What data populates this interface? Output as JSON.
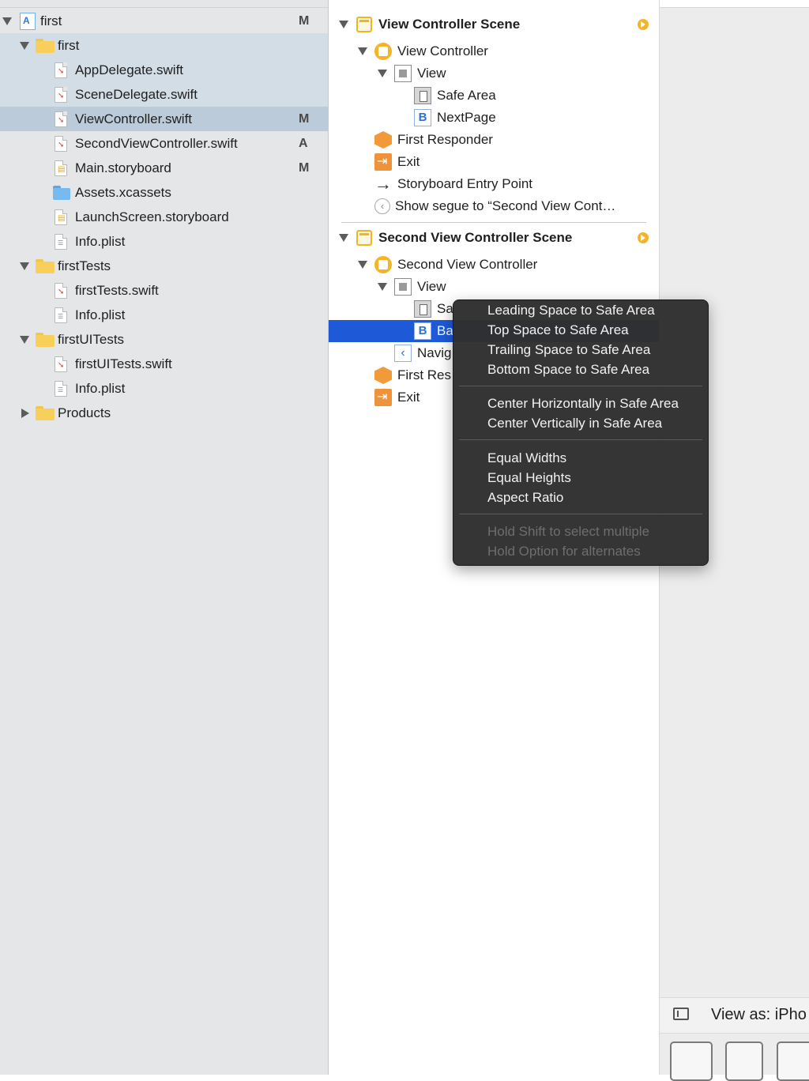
{
  "navigator": {
    "items": [
      {
        "label": "first",
        "status": "M",
        "kind": "project"
      },
      {
        "label": "first",
        "status": "",
        "kind": "folder"
      },
      {
        "label": "AppDelegate.swift",
        "status": "",
        "kind": "swift"
      },
      {
        "label": "SceneDelegate.swift",
        "status": "",
        "kind": "swift"
      },
      {
        "label": "ViewController.swift",
        "status": "M",
        "kind": "swift",
        "selected": true
      },
      {
        "label": "SecondViewController.swift",
        "status": "A",
        "kind": "swift"
      },
      {
        "label": "Main.storyboard",
        "status": "M",
        "kind": "storyboard"
      },
      {
        "label": "Assets.xcassets",
        "status": "",
        "kind": "assets"
      },
      {
        "label": "LaunchScreen.storyboard",
        "status": "",
        "kind": "storyboard"
      },
      {
        "label": "Info.plist",
        "status": "",
        "kind": "plist"
      },
      {
        "label": "firstTests",
        "status": "",
        "kind": "folder"
      },
      {
        "label": "firstTests.swift",
        "status": "",
        "kind": "swift"
      },
      {
        "label": "Info.plist",
        "status": "",
        "kind": "plist"
      },
      {
        "label": "firstUITests",
        "status": "",
        "kind": "folder"
      },
      {
        "label": "firstUITests.swift",
        "status": "",
        "kind": "swift"
      },
      {
        "label": "Info.plist",
        "status": "",
        "kind": "plist"
      },
      {
        "label": "Products",
        "status": "",
        "kind": "folder"
      }
    ]
  },
  "outline": {
    "scene1": {
      "title": "View Controller Scene",
      "view_controller": "View Controller",
      "view": "View",
      "safe_area": "Safe Area",
      "button": "NextPage",
      "first_responder": "First Responder",
      "exit": "Exit",
      "entry_point": "Storyboard Entry Point",
      "segue": "Show segue to “Second View Cont…"
    },
    "scene2": {
      "title": "Second View Controller Scene",
      "view_controller": "Second View Controller",
      "view": "View",
      "safe_area": "Sa",
      "button": "Ba",
      "navigation": "Navig",
      "first_responder": "First Res",
      "exit": "Exit"
    }
  },
  "context_menu": {
    "group1": [
      "Leading Space to Safe Area",
      "Top Space to Safe Area",
      "Trailing Space to Safe Area",
      "Bottom Space to Safe Area"
    ],
    "group2": [
      "Center Horizontally in Safe Area",
      "Center Vertically in Safe Area"
    ],
    "group3": [
      "Equal Widths",
      "Equal Heights",
      "Aspect Ratio"
    ],
    "hints": [
      "Hold Shift to select multiple",
      "Hold Option for alternates"
    ]
  },
  "canvas": {
    "view_as": "View as: iPho"
  },
  "colors": {
    "selection_blue": "#1e5ad8",
    "navigator_bg": "#e4e6e8",
    "menu_bg": "#2e2e2e",
    "accent_yellow": "#f5b425"
  }
}
